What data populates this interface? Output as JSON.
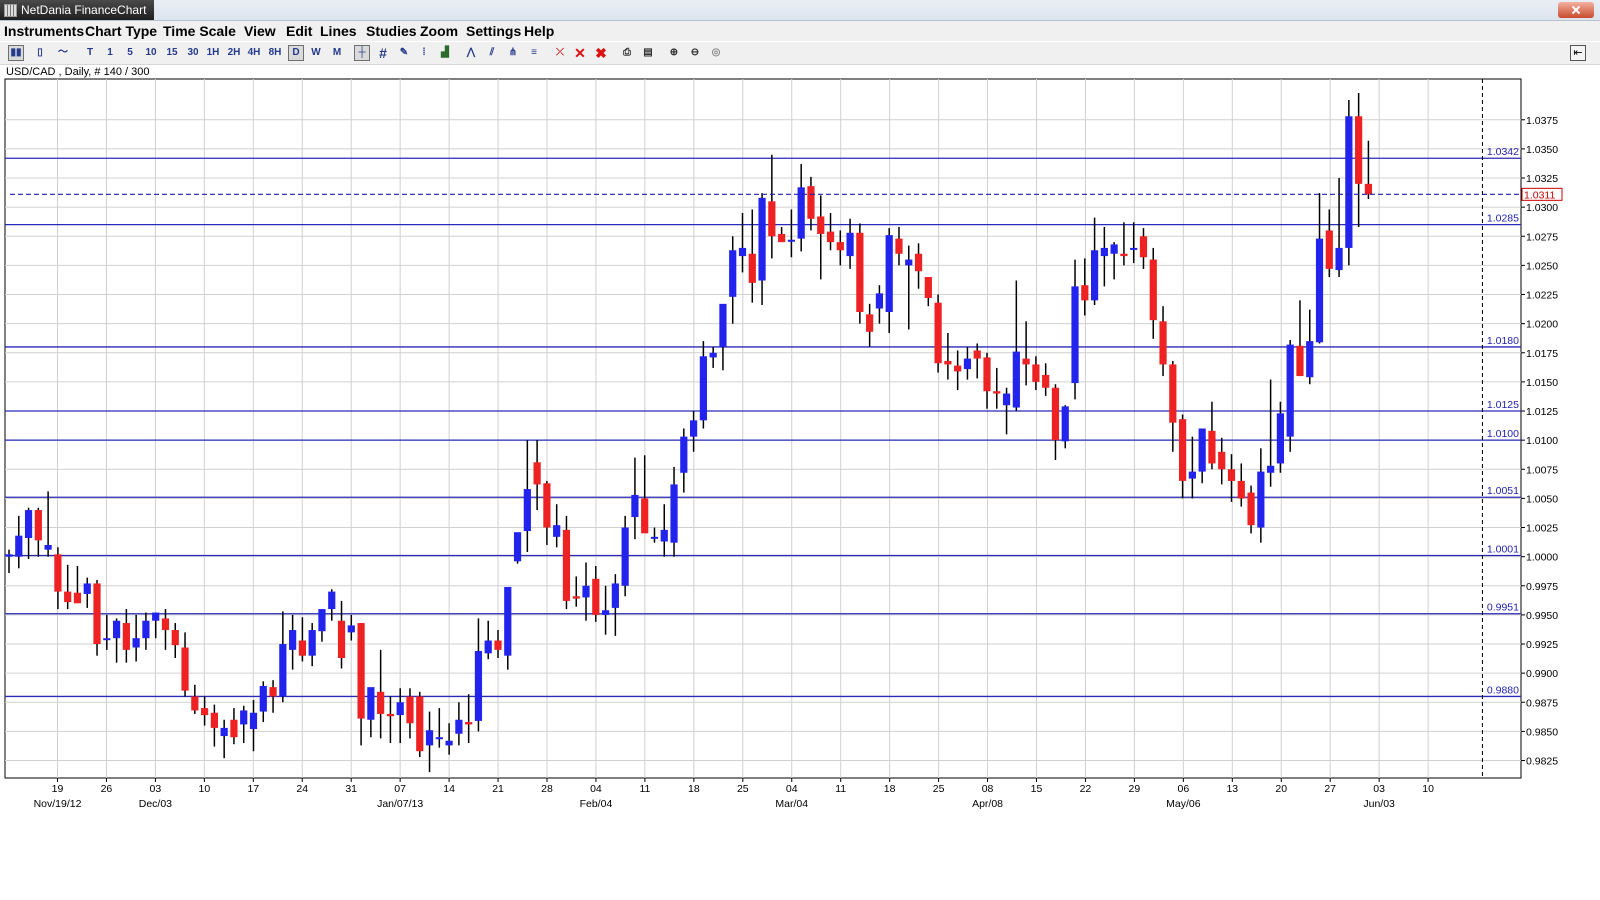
{
  "window": {
    "title": "NetDania FinanceChart"
  },
  "menu": [
    "Instruments",
    "Chart Type",
    "Time Scale",
    "View",
    "Edit",
    "Lines",
    "Studies",
    "Zoom",
    "Settings",
    "Help"
  ],
  "toolbar": {
    "period_buttons": [
      "T",
      "1",
      "5",
      "10",
      "15",
      "30",
      "1H",
      "2H",
      "4H",
      "8H",
      "D",
      "W",
      "M"
    ],
    "selected_period": "D",
    "icons": [
      "bar-chart-icon",
      "candlestick-icon",
      "line-chart-icon",
      "crosshair-icon",
      "grid-icon",
      "cursor-icon",
      "indicator-icon",
      "volume-icon",
      "zigzag-icon",
      "channel-icon",
      "fork-icon",
      "fibonacci-icon",
      "remove-line-icon",
      "delete-icon",
      "delete-all-icon",
      "print-icon",
      "print-preview-icon",
      "zoom-in-icon",
      "zoom-out-icon",
      "zoom-reset-icon"
    ]
  },
  "colors": {
    "up": "#2323ee",
    "down": "#ee2222",
    "wick": "#000000",
    "hline": "#2a2ab8",
    "grid": "#d0d0d0",
    "current": "#cc0000"
  },
  "chart_data": {
    "type": "candlestick",
    "title": "USD/CAD , Daily, # 140 / 300",
    "instrument": "USD/CAD",
    "timeframe": "Daily",
    "ylim": [
      0.981,
      1.041
    ],
    "grid": true,
    "y_ticks": [
      "1.0375",
      "1.0350",
      "1.0325",
      "1.0300",
      "1.0275",
      "1.0250",
      "1.0225",
      "1.0200",
      "1.0175",
      "1.0150",
      "1.0125",
      "1.0100",
      "1.0075",
      "1.0050",
      "1.0025",
      "1.0000",
      "0.9975",
      "0.9950",
      "0.9925",
      "0.9900",
      "0.9875",
      "0.9850",
      "0.9825"
    ],
    "x_ticks": [
      "19",
      "26",
      "03",
      "10",
      "17",
      "24",
      "31",
      "07",
      "14",
      "21",
      "28",
      "04",
      "11",
      "18",
      "25",
      "04",
      "11",
      "18",
      "25",
      "08",
      "15",
      "22",
      "29",
      "06",
      "13",
      "20",
      "27",
      "03",
      "10"
    ],
    "x_major": [
      {
        "label": "Nov/19/12",
        "tick": 0
      },
      {
        "label": "Dec/03",
        "tick": 2
      },
      {
        "label": "Jan/07/13",
        "tick": 7
      },
      {
        "label": "Feb/04",
        "tick": 11
      },
      {
        "label": "Mar/04",
        "tick": 15
      },
      {
        "label": "Apr/08",
        "tick": 19
      },
      {
        "label": "May/06",
        "tick": 23
      },
      {
        "label": "Jun/03",
        "tick": 27
      }
    ],
    "hlines": [
      "1.0342",
      "1.0285",
      "1.0180",
      "1.0125",
      "1.0100",
      "1.0051",
      "1.0001",
      "0.9951",
      "0.9880"
    ],
    "current_price": "1.0311",
    "candles": [
      {
        "o": 1.0,
        "h": 1.0006,
        "l": 0.9986,
        "c": 1.0002
      },
      {
        "o": 1.0,
        "h": 1.0035,
        "l": 0.999,
        "c": 1.0018
      },
      {
        "o": 1.0016,
        "h": 1.0042,
        "l": 0.9998,
        "c": 1.004
      },
      {
        "o": 1.004,
        "h": 1.0042,
        "l": 1.0,
        "c": 1.0014
      },
      {
        "o": 1.0006,
        "h": 1.0056,
        "l": 1.0,
        "c": 1.001
      },
      {
        "o": 1.0002,
        "h": 1.0008,
        "l": 0.9955,
        "c": 0.997
      },
      {
        "o": 0.997,
        "h": 0.9993,
        "l": 0.9955,
        "c": 0.9961
      },
      {
        "o": 0.9969,
        "h": 0.9992,
        "l": 0.996,
        "c": 0.996
      },
      {
        "o": 0.9968,
        "h": 0.9982,
        "l": 0.9956,
        "c": 0.9977
      },
      {
        "o": 0.9977,
        "h": 0.998,
        "l": 0.9915,
        "c": 0.9925
      },
      {
        "o": 0.993,
        "h": 0.995,
        "l": 0.992,
        "c": 0.993
      },
      {
        "o": 0.993,
        "h": 0.9947,
        "l": 0.9909,
        "c": 0.9945
      },
      {
        "o": 0.9943,
        "h": 0.9955,
        "l": 0.9909,
        "c": 0.992
      },
      {
        "o": 0.9922,
        "h": 0.995,
        "l": 0.991,
        "c": 0.993
      },
      {
        "o": 0.993,
        "h": 0.9952,
        "l": 0.992,
        "c": 0.9945
      },
      {
        "o": 0.9945,
        "h": 0.9952,
        "l": 0.993,
        "c": 0.9952
      },
      {
        "o": 0.9947,
        "h": 0.9955,
        "l": 0.992,
        "c": 0.9937
      },
      {
        "o": 0.9937,
        "h": 0.9943,
        "l": 0.9913,
        "c": 0.9924
      },
      {
        "o": 0.9922,
        "h": 0.9935,
        "l": 0.988,
        "c": 0.9885
      },
      {
        "o": 0.988,
        "h": 0.989,
        "l": 0.9865,
        "c": 0.9868
      },
      {
        "o": 0.987,
        "h": 0.988,
        "l": 0.9855,
        "c": 0.9864
      },
      {
        "o": 0.9866,
        "h": 0.9873,
        "l": 0.9837,
        "c": 0.9853
      },
      {
        "o": 0.9846,
        "h": 0.986,
        "l": 0.9827,
        "c": 0.9853
      },
      {
        "o": 0.986,
        "h": 0.987,
        "l": 0.9839,
        "c": 0.9845
      },
      {
        "o": 0.9856,
        "h": 0.9872,
        "l": 0.984,
        "c": 0.9868
      },
      {
        "o": 0.9852,
        "h": 0.9877,
        "l": 0.9833,
        "c": 0.9866
      },
      {
        "o": 0.9867,
        "h": 0.9893,
        "l": 0.9858,
        "c": 0.9889
      },
      {
        "o": 0.9888,
        "h": 0.9894,
        "l": 0.9866,
        "c": 0.988
      },
      {
        "o": 0.988,
        "h": 0.9953,
        "l": 0.9875,
        "c": 0.9925
      },
      {
        "o": 0.992,
        "h": 0.995,
        "l": 0.9903,
        "c": 0.9937
      },
      {
        "o": 0.9928,
        "h": 0.9948,
        "l": 0.991,
        "c": 0.9915
      },
      {
        "o": 0.9915,
        "h": 0.9943,
        "l": 0.9906,
        "c": 0.9937
      },
      {
        "o": 0.9936,
        "h": 0.9953,
        "l": 0.9927,
        "c": 0.9955
      },
      {
        "o": 0.9955,
        "h": 0.9972,
        "l": 0.9945,
        "c": 0.997
      },
      {
        "o": 0.9945,
        "h": 0.9962,
        "l": 0.9904,
        "c": 0.9913
      },
      {
        "o": 0.9935,
        "h": 0.995,
        "l": 0.9928,
        "c": 0.9941
      },
      {
        "o": 0.9943,
        "h": 0.9943,
        "l": 0.9838,
        "c": 0.9861
      },
      {
        "o": 0.986,
        "h": 0.9882,
        "l": 0.9845,
        "c": 0.9888
      },
      {
        "o": 0.9884,
        "h": 0.992,
        "l": 0.9844,
        "c": 0.9865
      },
      {
        "o": 0.9865,
        "h": 0.988,
        "l": 0.984,
        "c": 0.9863
      },
      {
        "o": 0.9864,
        "h": 0.9887,
        "l": 0.984,
        "c": 0.9875
      },
      {
        "o": 0.988,
        "h": 0.9887,
        "l": 0.9844,
        "c": 0.9857
      },
      {
        "o": 0.988,
        "h": 0.9884,
        "l": 0.9828,
        "c": 0.9833
      },
      {
        "o": 0.9838,
        "h": 0.9867,
        "l": 0.9815,
        "c": 0.9851
      },
      {
        "o": 0.9845,
        "h": 0.987,
        "l": 0.9836,
        "c": 0.9845
      },
      {
        "o": 0.9838,
        "h": 0.9857,
        "l": 0.983,
        "c": 0.9842
      },
      {
        "o": 0.9848,
        "h": 0.9875,
        "l": 0.9838,
        "c": 0.986
      },
      {
        "o": 0.9858,
        "h": 0.9882,
        "l": 0.984,
        "c": 0.9856
      },
      {
        "o": 0.9859,
        "h": 0.9947,
        "l": 0.985,
        "c": 0.9919
      },
      {
        "o": 0.9917,
        "h": 0.9945,
        "l": 0.9912,
        "c": 0.9928
      },
      {
        "o": 0.9928,
        "h": 0.9937,
        "l": 0.9913,
        "c": 0.992
      },
      {
        "o": 0.9915,
        "h": 0.9938,
        "l": 0.9903,
        "c": 0.9974
      },
      {
        "o": 0.9996,
        "h": 1.002,
        "l": 0.9994,
        "c": 1.0021
      },
      {
        "o": 1.0022,
        "h": 1.01,
        "l": 1.0004,
        "c": 1.0058
      },
      {
        "o": 1.0081,
        "h": 1.01,
        "l": 1.004,
        "c": 1.0062
      },
      {
        "o": 1.0063,
        "h": 1.0065,
        "l": 1.001,
        "c": 1.0025
      },
      {
        "o": 1.0017,
        "h": 1.0045,
        "l": 1.0008,
        "c": 1.0027
      },
      {
        "o": 1.0023,
        "h": 1.0035,
        "l": 0.9955,
        "c": 0.9962
      },
      {
        "o": 0.9966,
        "h": 0.9983,
        "l": 0.9957,
        "c": 0.9964
      },
      {
        "o": 0.9965,
        "h": 0.9995,
        "l": 0.9945,
        "c": 0.9975
      },
      {
        "o": 0.9981,
        "h": 0.9992,
        "l": 0.9944,
        "c": 0.995
      },
      {
        "o": 0.995,
        "h": 0.9975,
        "l": 0.9933,
        "c": 0.9954
      },
      {
        "o": 0.9956,
        "h": 0.9985,
        "l": 0.9932,
        "c": 0.9977
      },
      {
        "o": 0.9975,
        "h": 1.0035,
        "l": 0.9966,
        "c": 1.0025
      },
      {
        "o": 1.0034,
        "h": 1.0085,
        "l": 1.0015,
        "c": 1.0053
      },
      {
        "o": 1.005,
        "h": 1.0087,
        "l": 1.003,
        "c": 1.002
      },
      {
        "o": 1.0016,
        "h": 1.0025,
        "l": 1.0012,
        "c": 1.0017
      },
      {
        "o": 1.0013,
        "h": 1.0045,
        "l": 1.0,
        "c": 1.0023
      },
      {
        "o": 1.0012,
        "h": 1.0077,
        "l": 1.0,
        "c": 1.0062
      },
      {
        "o": 1.0072,
        "h": 1.011,
        "l": 1.0055,
        "c": 1.0103
      },
      {
        "o": 1.0103,
        "h": 1.0125,
        "l": 1.009,
        "c": 1.0117
      },
      {
        "o": 1.0117,
        "h": 1.0185,
        "l": 1.011,
        "c": 1.0172
      },
      {
        "o": 1.0171,
        "h": 1.018,
        "l": 1.0162,
        "c": 1.0175
      },
      {
        "o": 1.018,
        "h": 1.0205,
        "l": 1.016,
        "c": 1.0217
      },
      {
        "o": 1.0223,
        "h": 1.0275,
        "l": 1.02,
        "c": 1.0263
      },
      {
        "o": 1.0258,
        "h": 1.0295,
        "l": 1.0244,
        "c": 1.0265
      },
      {
        "o": 1.026,
        "h": 1.0298,
        "l": 1.0218,
        "c": 1.0235
      },
      {
        "o": 1.0237,
        "h": 1.0312,
        "l": 1.0216,
        "c": 1.0308
      },
      {
        "o": 1.0305,
        "h": 1.0345,
        "l": 1.0256,
        "c": 1.0275
      },
      {
        "o": 1.0277,
        "h": 1.0283,
        "l": 1.027,
        "c": 1.027
      },
      {
        "o": 1.0271,
        "h": 1.0298,
        "l": 1.0257,
        "c": 1.0272
      },
      {
        "o": 1.0273,
        "h": 1.0337,
        "l": 1.0262,
        "c": 1.0317
      },
      {
        "o": 1.0318,
        "h": 1.0326,
        "l": 1.028,
        "c": 1.029
      },
      {
        "o": 1.0292,
        "h": 1.031,
        "l": 1.0238,
        "c": 1.0277
      },
      {
        "o": 1.0279,
        "h": 1.0295,
        "l": 1.0263,
        "c": 1.027
      },
      {
        "o": 1.027,
        "h": 1.028,
        "l": 1.025,
        "c": 1.0263
      },
      {
        "o": 1.0258,
        "h": 1.029,
        "l": 1.0247,
        "c": 1.0278
      },
      {
        "o": 1.0278,
        "h": 1.0286,
        "l": 1.02,
        "c": 1.021
      },
      {
        "o": 1.0208,
        "h": 1.0217,
        "l": 1.018,
        "c": 1.0193
      },
      {
        "o": 1.0213,
        "h": 1.0233,
        "l": 1.02,
        "c": 1.0226
      },
      {
        "o": 1.021,
        "h": 1.0282,
        "l": 1.0192,
        "c": 1.0276
      },
      {
        "o": 1.0273,
        "h": 1.0283,
        "l": 1.025,
        "c": 1.026
      },
      {
        "o": 1.025,
        "h": 1.0267,
        "l": 1.0195,
        "c": 1.0255
      },
      {
        "o": 1.026,
        "h": 1.0269,
        "l": 1.023,
        "c": 1.0245
      },
      {
        "o": 1.024,
        "h": 1.024,
        "l": 1.0215,
        "c": 1.0222
      },
      {
        "o": 1.0218,
        "h": 1.0225,
        "l": 1.0158,
        "c": 1.0166
      },
      {
        "o": 1.0168,
        "h": 1.0192,
        "l": 1.0152,
        "c": 1.0165
      },
      {
        "o": 1.0164,
        "h": 1.0177,
        "l": 1.0143,
        "c": 1.0159
      },
      {
        "o": 1.0161,
        "h": 1.018,
        "l": 1.0152,
        "c": 1.017
      },
      {
        "o": 1.0177,
        "h": 1.0183,
        "l": 1.0153,
        "c": 1.017
      },
      {
        "o": 1.0171,
        "h": 1.0175,
        "l": 1.0127,
        "c": 1.0142
      },
      {
        "o": 1.0142,
        "h": 1.0162,
        "l": 1.0127,
        "c": 1.014
      },
      {
        "o": 1.013,
        "h": 1.0145,
        "l": 1.0105,
        "c": 1.014
      },
      {
        "o": 1.0128,
        "h": 1.0237,
        "l": 1.0125,
        "c": 1.0176
      },
      {
        "o": 1.017,
        "h": 1.0202,
        "l": 1.0147,
        "c": 1.0165
      },
      {
        "o": 1.0165,
        "h": 1.0172,
        "l": 1.0143,
        "c": 1.015
      },
      {
        "o": 1.0156,
        "h": 1.0166,
        "l": 1.0138,
        "c": 1.0145
      },
      {
        "o": 1.0145,
        "h": 1.0148,
        "l": 1.0083,
        "c": 1.01
      },
      {
        "o": 1.0099,
        "h": 1.013,
        "l": 1.0093,
        "c": 1.0129
      },
      {
        "o": 1.0149,
        "h": 1.0255,
        "l": 1.0135,
        "c": 1.0232
      },
      {
        "o": 1.0233,
        "h": 1.0256,
        "l": 1.0207,
        "c": 1.022
      },
      {
        "o": 1.022,
        "h": 1.0291,
        "l": 1.0216,
        "c": 1.0263
      },
      {
        "o": 1.0258,
        "h": 1.0283,
        "l": 1.0232,
        "c": 1.0265
      },
      {
        "o": 1.026,
        "h": 1.027,
        "l": 1.0238,
        "c": 1.0268
      },
      {
        "o": 1.026,
        "h": 1.0287,
        "l": 1.025,
        "c": 1.0258
      },
      {
        "o": 1.0264,
        "h": 1.0287,
        "l": 1.0252,
        "c": 1.0265
      },
      {
        "o": 1.0275,
        "h": 1.0282,
        "l": 1.0247,
        "c": 1.0257
      },
      {
        "o": 1.0255,
        "h": 1.0265,
        "l": 1.0187,
        "c": 1.0203
      },
      {
        "o": 1.0202,
        "h": 1.0215,
        "l": 1.0155,
        "c": 1.0165
      },
      {
        "o": 1.0165,
        "h": 1.0168,
        "l": 1.009,
        "c": 1.0115
      },
      {
        "o": 1.0118,
        "h": 1.0122,
        "l": 1.005,
        "c": 1.0065
      },
      {
        "o": 1.0067,
        "h": 1.0103,
        "l": 1.005,
        "c": 1.0073
      },
      {
        "o": 1.0073,
        "h": 1.011,
        "l": 1.0063,
        "c": 1.011
      },
      {
        "o": 1.0108,
        "h": 1.0133,
        "l": 1.0075,
        "c": 1.008
      },
      {
        "o": 1.009,
        "h": 1.0102,
        "l": 1.0062,
        "c": 1.0075
      },
      {
        "o": 1.0075,
        "h": 1.0088,
        "l": 1.0047,
        "c": 1.0065
      },
      {
        "o": 1.0065,
        "h": 1.008,
        "l": 1.0043,
        "c": 1.005
      },
      {
        "o": 1.0055,
        "h": 1.0061,
        "l": 1.002,
        "c": 1.0027
      },
      {
        "o": 1.0025,
        "h": 1.0093,
        "l": 1.0012,
        "c": 1.0073
      },
      {
        "o": 1.0072,
        "h": 1.0152,
        "l": 1.006,
        "c": 1.0078
      },
      {
        "o": 1.008,
        "h": 1.0133,
        "l": 1.0072,
        "c": 1.0123
      },
      {
        "o": 1.0103,
        "h": 1.0186,
        "l": 1.009,
        "c": 1.0182
      },
      {
        "o": 1.0181,
        "h": 1.022,
        "l": 1.0155,
        "c": 1.0155
      },
      {
        "o": 1.0154,
        "h": 1.0212,
        "l": 1.0148,
        "c": 1.0185
      },
      {
        "o": 1.0184,
        "h": 1.0312,
        "l": 1.0183,
        "c": 1.0273
      },
      {
        "o": 1.028,
        "h": 1.0298,
        "l": 1.024,
        "c": 1.0247
      },
      {
        "o": 1.0246,
        "h": 1.0325,
        "l": 1.024,
        "c": 1.0265
      },
      {
        "o": 1.0265,
        "h": 1.0392,
        "l": 1.025,
        "c": 1.0378
      },
      {
        "o": 1.0378,
        "h": 1.0398,
        "l": 1.0283,
        "c": 1.032
      },
      {
        "o": 1.032,
        "h": 1.0357,
        "l": 1.0307,
        "c": 1.0311
      }
    ]
  }
}
